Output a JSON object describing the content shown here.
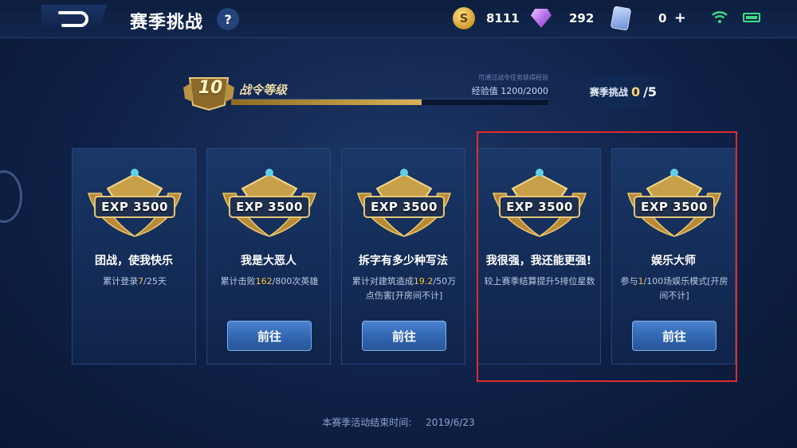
{
  "header": {
    "title": "赛季挑战",
    "help": "?",
    "gold": "8111",
    "gems": "292",
    "cards": "0",
    "plus": "+"
  },
  "progress": {
    "level": "10",
    "level_label": "战令等级",
    "hint": "可通过战令任务获得经验",
    "exp_text": "经验值 1200/2000",
    "exp_current": 1200,
    "exp_max": 2000,
    "challenge_label": "赛季挑战",
    "challenge_done": "0",
    "challenge_total": "/5"
  },
  "cards": [
    {
      "exp": "EXP 3500",
      "title": "团战，使我快乐",
      "desc_prefix": "累计登录",
      "desc_highlight": "7",
      "desc_suffix": "/25天",
      "button": ""
    },
    {
      "exp": "EXP 3500",
      "title": "我是大恶人",
      "desc_prefix": "累计击败",
      "desc_highlight": "162",
      "desc_suffix": "/800次英雄",
      "button": "前往"
    },
    {
      "exp": "EXP 3500",
      "title": "拆字有多少种写法",
      "desc_prefix": "累计对建筑造成",
      "desc_highlight": "19.2",
      "desc_suffix": "/50万点伤害[开房间不计]",
      "button": "前往"
    },
    {
      "exp": "EXP 3500",
      "title": "我很强，我还能更强!",
      "desc_prefix": "较上赛季结算提升5排位星数",
      "desc_highlight": "",
      "desc_suffix": "",
      "button": ""
    },
    {
      "exp": "EXP 3500",
      "title": "娱乐大师",
      "desc_prefix": "参与",
      "desc_highlight": "1",
      "desc_suffix": "/100场娱乐模式[开房间不计]",
      "button": "前往"
    }
  ],
  "footer": {
    "label": "本赛季活动结束时间:",
    "date": "2019/6/23"
  },
  "colors": {
    "accent_gold": "#f4c04a",
    "button_blue": "#3a71bd",
    "highlight_red": "#e02a2a"
  }
}
